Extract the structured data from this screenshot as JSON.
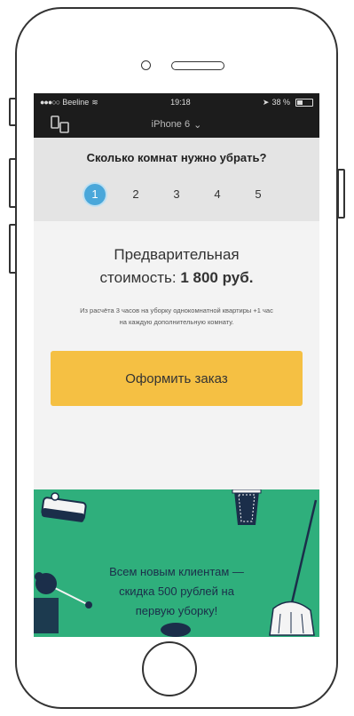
{
  "status_bar": {
    "carrier": "Beeline",
    "time": "19:18",
    "battery": "38 %"
  },
  "nav": {
    "device_label": "iPhone 6"
  },
  "rooms": {
    "question": "Сколько комнат нужно убрать?",
    "options": [
      "1",
      "2",
      "3",
      "4",
      "5"
    ],
    "selected": "1"
  },
  "price": {
    "label_line1": "Предварительная",
    "label_line2": "стоимость:",
    "value": "1 800 руб.",
    "note": "Из расчёта 3 часов на уборку однокомнатной квартиры +1 час на каждую дополнительную комнату."
  },
  "order_button": {
    "label": "Оформить заказ"
  },
  "promo": {
    "line1": "Всем новым клиентам —",
    "line2": "скидка 500 рублей на",
    "line3": "первую уборку!"
  },
  "colors": {
    "accent_blue": "#4aa7da",
    "button_yellow": "#f5c043",
    "promo_green": "#2faf7c",
    "dark_bar": "#1c1c1c"
  }
}
